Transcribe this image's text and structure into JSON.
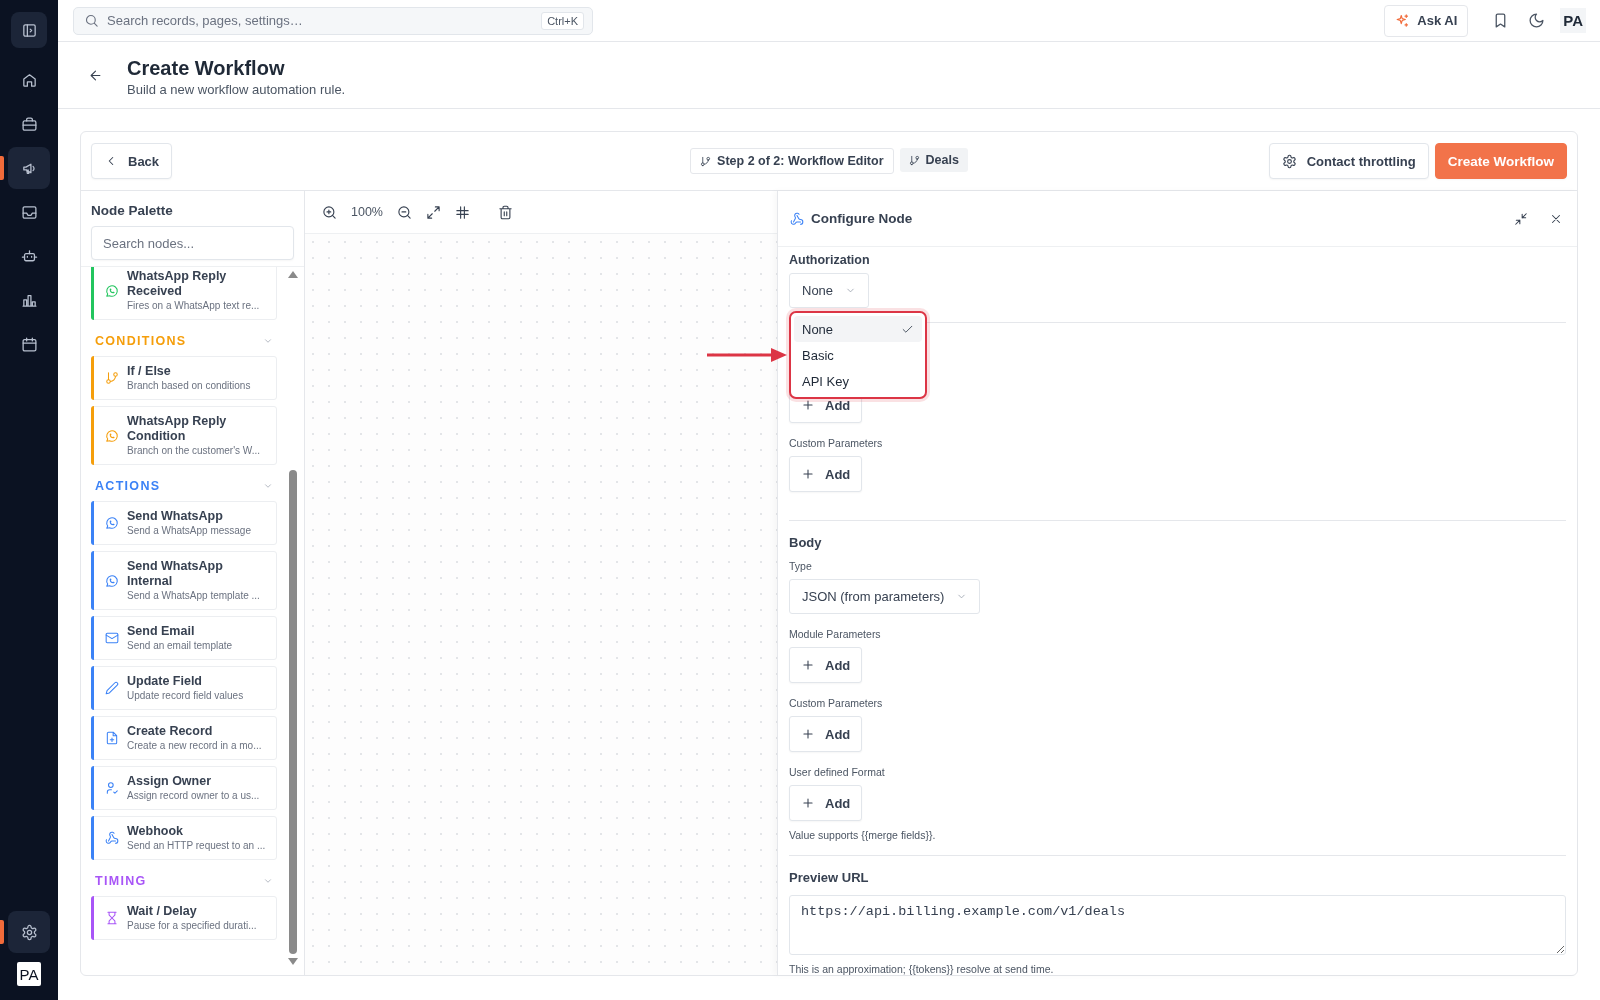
{
  "nav": {
    "items": [
      {
        "kind": "panel",
        "selected": false
      },
      {
        "kind": "home",
        "selected": false
      },
      {
        "kind": "briefcase",
        "selected": false
      },
      {
        "kind": "megaphone",
        "selected": true
      },
      {
        "kind": "inbox",
        "selected": false
      },
      {
        "kind": "bot",
        "selected": false
      },
      {
        "kind": "chart",
        "selected": false
      },
      {
        "kind": "calendar",
        "selected": false
      }
    ],
    "bottom": [
      {
        "kind": "gear",
        "selected": true
      }
    ],
    "avatar": "PA"
  },
  "topbar": {
    "search": {
      "placeholder": "Search records, pages, settings…",
      "shortcut": "Ctrl+K"
    },
    "ask_ai": "Ask AI",
    "avatar": "PA"
  },
  "header": {
    "title": "Create Workflow",
    "subtitle": "Build a new workflow automation rule."
  },
  "toolbar": {
    "back": "Back",
    "step": "Step 2 of 2: Workflow Editor",
    "module": "Deals",
    "throttling": "Contact throttling",
    "create": "Create Workflow"
  },
  "palette": {
    "title": "Node Palette",
    "search": {
      "placeholder": "Search nodes..."
    },
    "sections": [
      {
        "color": "#22c55e",
        "items": [
          {
            "kind": "whatsapp",
            "title": "WhatsApp Reply Received",
            "description": "Fires on a WhatsApp text re..."
          }
        ]
      },
      {
        "title": "CONDITIONS",
        "expanded": true,
        "color": "#f59e0b",
        "items": [
          {
            "kind": "branch",
            "title": "If / Else",
            "description": "Branch based on conditions"
          },
          {
            "kind": "whatsapp",
            "title": "WhatsApp Reply Condition",
            "description": "Branch on the customer's W..."
          }
        ]
      },
      {
        "title": "ACTIONS",
        "expanded": true,
        "color": "#3b82f6",
        "items": [
          {
            "kind": "whatsapp",
            "title": "Send WhatsApp",
            "description": "Send a WhatsApp message"
          },
          {
            "kind": "whatsapp",
            "title": "Send WhatsApp Internal",
            "description": "Send a WhatsApp template ..."
          },
          {
            "kind": "mail",
            "title": "Send Email",
            "description": "Send an email template"
          },
          {
            "kind": "pencil",
            "title": "Update Field",
            "description": "Update record field values"
          },
          {
            "kind": "file",
            "title": "Create Record",
            "description": "Create a new record in a mo..."
          },
          {
            "kind": "user",
            "title": "Assign Owner",
            "description": "Assign record owner to a us..."
          },
          {
            "kind": "webhook",
            "title": "Webhook",
            "description": "Send an HTTP request to an ..."
          }
        ]
      },
      {
        "title": "TIMING",
        "expanded": true,
        "color": "#a855f7",
        "items": [
          {
            "kind": "hourglass",
            "title": "Wait / Delay",
            "description": "Pause for a specified durati..."
          }
        ]
      }
    ]
  },
  "canvas": {
    "zoom": "100%"
  },
  "config": {
    "title": "Configure Node",
    "fields": [
      {
        "kind": "select",
        "label": "Authorization",
        "value": "None",
        "open": true,
        "options": [
          {
            "label": "None",
            "selected": true
          },
          {
            "label": "Basic",
            "selected": false
          },
          {
            "label": "API Key",
            "selected": false
          }
        ]
      },
      {
        "kind": "divider"
      },
      {
        "kind": "add",
        "text": "Add"
      },
      {
        "kind": "add",
        "label": "Custom Parameters",
        "text": "Add"
      },
      {
        "kind": "divider"
      },
      {
        "kind": "heading",
        "text": "Body"
      },
      {
        "kind": "select",
        "label": "Type",
        "value": "JSON (from parameters)"
      },
      {
        "kind": "add",
        "label": "Module Parameters",
        "text": "Add"
      },
      {
        "kind": "add",
        "label": "Custom Parameters",
        "text": "Add"
      },
      {
        "kind": "add",
        "label": "User defined Format",
        "text": "Add"
      },
      {
        "kind": "hint",
        "text": "Value supports {{merge fields}}."
      },
      {
        "kind": "divider"
      },
      {
        "kind": "heading",
        "text": "Preview URL"
      },
      {
        "kind": "textarea",
        "value": "https://api.billing.example.com/v1/deals"
      },
      {
        "kind": "hint",
        "text": "This is an approximation; {{tokens}} resolve at send time."
      }
    ]
  }
}
